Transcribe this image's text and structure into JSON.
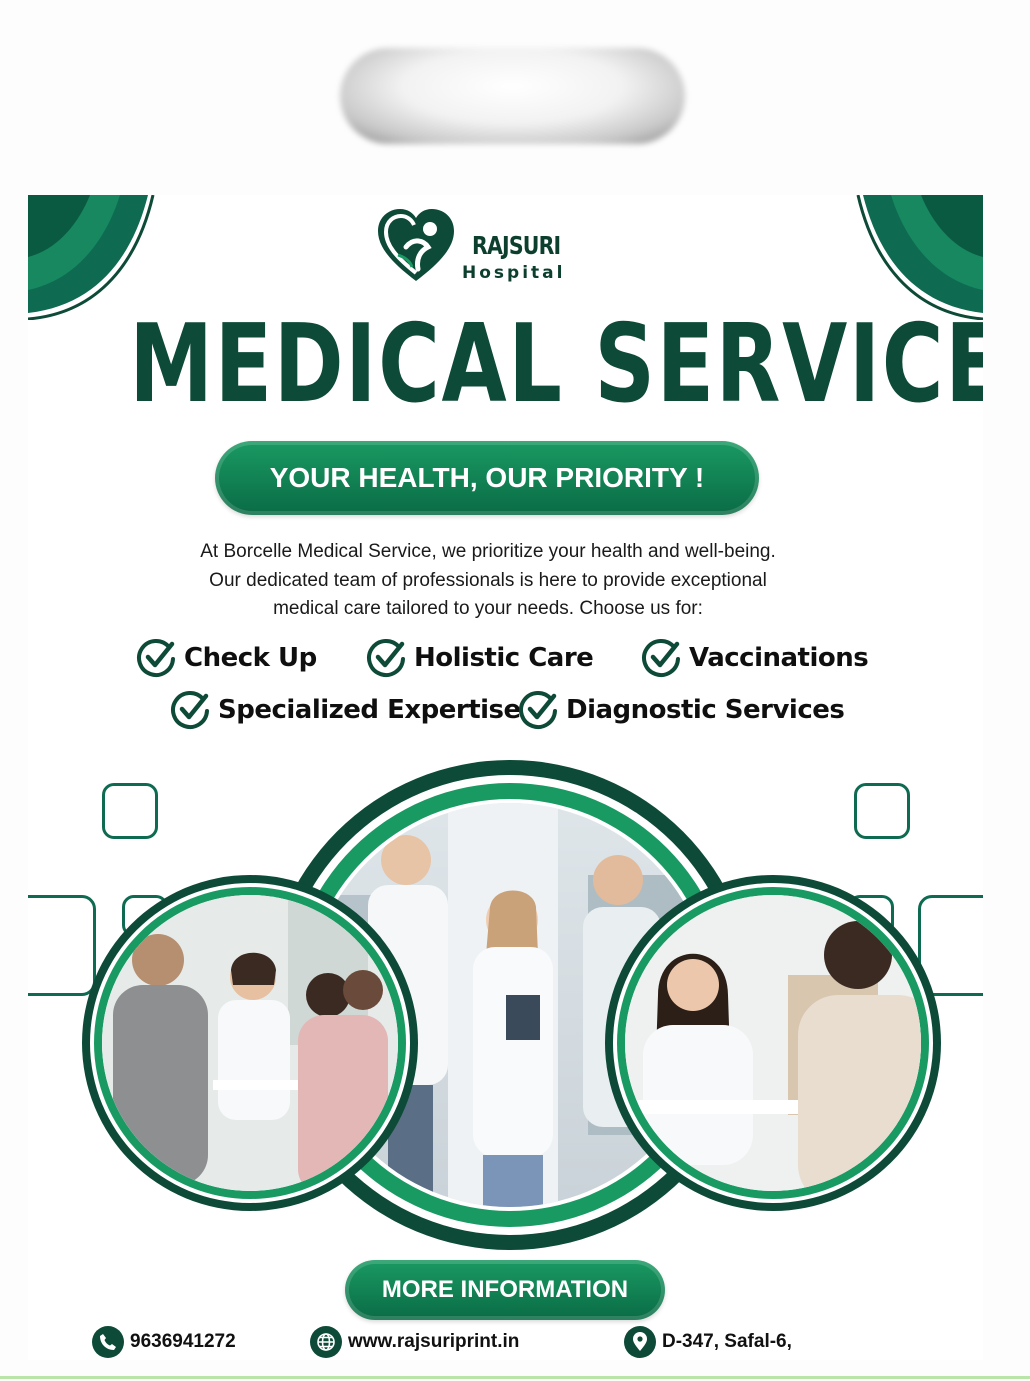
{
  "brand": {
    "name": "RAJSURI",
    "sub": "Hospital"
  },
  "headline": "MEDICAL SERVICE",
  "tagline": "YOUR HEALTH, OUR PRIORITY !",
  "intro": [
    "At Borcelle Medical Service, we prioritize your health and well-being.",
    "Our dedicated team of professionals is here to provide exceptional",
    "medical care tailored to your needs. Choose us for:"
  ],
  "features": [
    "Check Up",
    "Holistic Care",
    "Vaccinations",
    "Specialized Expertise",
    "Diagnostic Services"
  ],
  "cta": "MORE INFORMATION",
  "contact": {
    "phone": "9636941272",
    "website": "www.rajsuriprint.in",
    "address": "D-347, Safal-6,"
  },
  "colors": {
    "dark_green": "#0d4a37",
    "bright_green": "#1a9a63",
    "accent": "#0e6a50"
  },
  "icons": [
    "logo-heart-icon",
    "check-circle-icon",
    "phone-icon",
    "globe-icon",
    "location-pin-icon"
  ]
}
